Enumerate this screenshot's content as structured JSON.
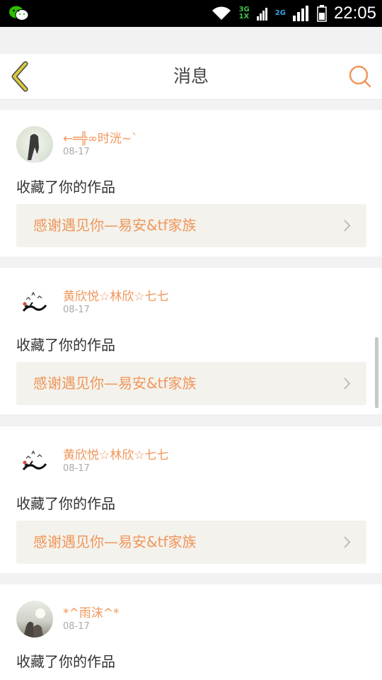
{
  "status_bar": {
    "time": "22:05",
    "net1_top": "3G",
    "net1_bottom": "1X",
    "net2": "2G",
    "icons": [
      "wechat-icon",
      "wifi-icon",
      "signal-icon",
      "battery-icon"
    ]
  },
  "header": {
    "title": "消息",
    "back_icon": "chevron-left-icon",
    "search_icon": "search-icon"
  },
  "colors": {
    "accent": "#f0965a",
    "back_arrow": "#c9b933",
    "link_bg": "#f3f2ec"
  },
  "messages": [
    {
      "user": "←═╬∞时洸~`",
      "date": "08-17",
      "action": "收藏了你的作品",
      "work": "感谢遇见你—易安&tf家族"
    },
    {
      "user": "黄欣悦☆林欣☆七七",
      "date": "08-17",
      "action": "收藏了你的作品",
      "work": "感谢遇见你—易安&tf家族"
    },
    {
      "user": "黄欣悦☆林欣☆七七",
      "date": "08-17",
      "action": "收藏了你的作品",
      "work": "感谢遇见你—易安&tf家族"
    },
    {
      "user": "*^雨沫^*",
      "date": "08-17",
      "action": "收藏了你的作品",
      "work": ""
    }
  ]
}
